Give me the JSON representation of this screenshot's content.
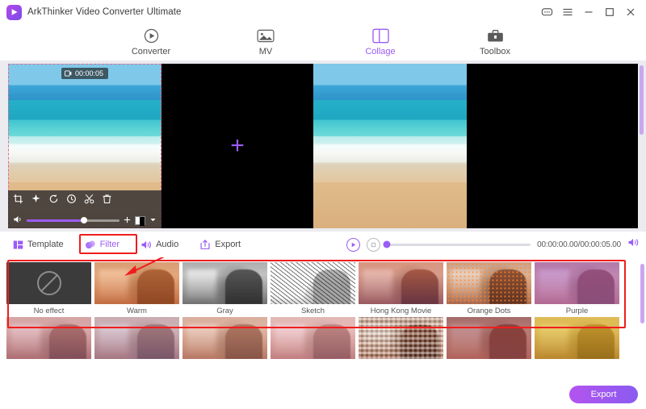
{
  "window": {
    "title": "ArkThinker Video Converter Ultimate",
    "controls": {
      "feedback": "feedback-icon",
      "menu": "hamburger-menu-icon",
      "minimize": "minimize-icon",
      "maximize": "maximize-icon",
      "close": "close-icon"
    }
  },
  "nav": {
    "tabs": [
      {
        "label": "Converter",
        "icon": "converter-icon",
        "active": false
      },
      {
        "label": "MV",
        "icon": "mv-icon",
        "active": false
      },
      {
        "label": "Collage",
        "icon": "collage-icon",
        "active": true
      },
      {
        "label": "Toolbox",
        "icon": "toolbox-icon",
        "active": false
      }
    ]
  },
  "preview": {
    "clip_time_badge": "00:00:05",
    "add_placeholder": "+",
    "clip_tools": [
      "crop-icon",
      "effect-icon",
      "rotate-icon",
      "reset-icon",
      "trim-icon",
      "delete-icon"
    ],
    "volume_percent": 62
  },
  "toolbar": {
    "items": [
      {
        "label": "Template",
        "icon": "template-icon",
        "active": false
      },
      {
        "label": "Filter",
        "icon": "filter-icon",
        "active": true
      },
      {
        "label": "Audio",
        "icon": "audio-icon",
        "active": false
      },
      {
        "label": "Export",
        "icon": "export-icon",
        "active": false
      }
    ],
    "player": {
      "play": "play-icon",
      "stop": "stop-icon",
      "timecode": "00:00:00.00/00:00:05.00",
      "volume": "volume-icon",
      "seek_position_percent": 0
    }
  },
  "filters": {
    "row1": [
      {
        "label": "No effect",
        "style": "noeffect"
      },
      {
        "label": "Warm",
        "style": "warm"
      },
      {
        "label": "Gray",
        "style": "gray"
      },
      {
        "label": "Sketch",
        "style": "sketch"
      },
      {
        "label": "Hong Kong Movie",
        "style": "hk"
      },
      {
        "label": "Orange Dots",
        "style": "dots"
      },
      {
        "label": "Purple",
        "style": "purple"
      }
    ],
    "row2": [
      {
        "label": "",
        "style": "r2a"
      },
      {
        "label": "",
        "style": "r2b"
      },
      {
        "label": "",
        "style": "r2c"
      },
      {
        "label": "",
        "style": "r2d"
      },
      {
        "label": "",
        "style": "r2e"
      },
      {
        "label": "",
        "style": "r2f"
      },
      {
        "label": "",
        "style": "r2g"
      }
    ]
  },
  "actions": {
    "export_label": "Export"
  },
  "colors": {
    "accent": "#9b5cf6",
    "annotation": "#ef1d1d",
    "selection": "#e06a8a",
    "panel_bg": "#ebebf0"
  }
}
